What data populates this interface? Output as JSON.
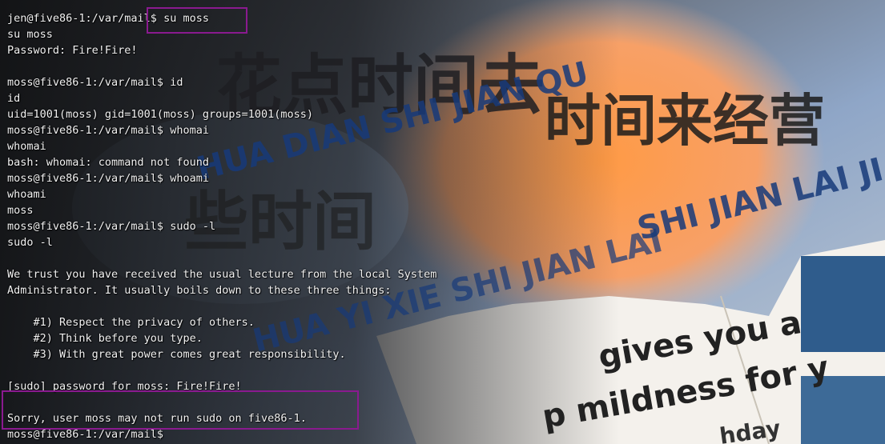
{
  "terminal": {
    "lines": [
      "jen@five86-1:/var/mail$ su moss",
      "su moss",
      "Password: Fire!Fire!",
      "",
      "moss@five86-1:/var/mail$ id",
      "id",
      "uid=1001(moss) gid=1001(moss) groups=1001(moss)",
      "moss@five86-1:/var/mail$ whomai",
      "whomai",
      "bash: whomai: command not found",
      "moss@five86-1:/var/mail$ whoami",
      "whoami",
      "moss",
      "moss@five86-1:/var/mail$ sudo -l",
      "sudo -l",
      "",
      "We trust you have received the usual lecture from the local System",
      "Administrator. It usually boils down to these three things:",
      "",
      "    #1) Respect the privacy of others.",
      "    #2) Think before you type.",
      "    #3) With great power comes great responsibility.",
      "",
      "[sudo] password for moss: Fire!Fire!",
      "",
      "Sorry, user moss may not run sudo on five86-1.",
      "moss@five86-1:/var/mail$"
    ]
  },
  "wallpaper": {
    "hanzi_top": "花点时间去",
    "hanzi_mid": "时间来经营",
    "hanzi_low": "些时间",
    "pinyin_1": "HUA DIAN SHI JIAN QU",
    "pinyin_2": "SHI JIAN LAI JI",
    "pinyin_3": "HUA YI XIE SHI JIAN LAI",
    "pinyin_4": "HUA",
    "card_1": "gives you a",
    "card_2": "p mildness for y",
    "card_3": "hday"
  },
  "colors": {
    "highlight": "#8a1a8f"
  }
}
